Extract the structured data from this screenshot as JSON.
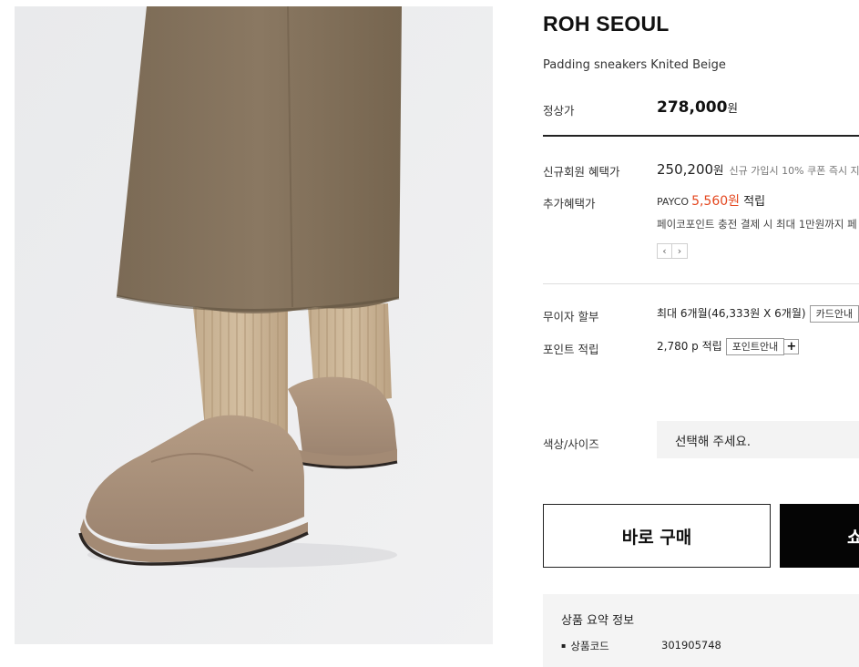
{
  "product": {
    "brand": "ROH SEOUL",
    "name": "Padding sneakers Knited Beige"
  },
  "pricing": {
    "regular_label": "정상가",
    "regular_price": "278,000",
    "currency_unit": "원",
    "member_label": "신규회원 혜택가",
    "member_price": "250,200",
    "member_note": "신규 가입시 10% 쿠폰 즉시 지",
    "extra_label": "추가혜택가",
    "payco_label": "PAYCO",
    "payco_points": "5,560원",
    "payco_earn": "적립",
    "payco_note": "페이코포인트 충전 결제 시 최대 1만원까지 페",
    "prev_arrow": "‹",
    "next_arrow": "›"
  },
  "installment": {
    "label": "무이자 할부",
    "value": "최대 6개월(46,333원 X 6개월)",
    "card_button": "카드안내"
  },
  "points": {
    "label": "포인트 적립",
    "value": "2,780 p 적립",
    "info_button": "포인트안내",
    "plus": "+"
  },
  "options": {
    "label": "색상/사이즈",
    "placeholder": "선택해 주세요."
  },
  "actions": {
    "buy_now": "바로 구매",
    "cart_partial": "쇼"
  },
  "summary": {
    "title": "상품 요약 정보",
    "code_label": "상품코드",
    "code_value": "301905748"
  },
  "colors": {
    "accent_orange": "#e4471f",
    "dark_button": "#050505",
    "photo_background": "#ecedef"
  }
}
